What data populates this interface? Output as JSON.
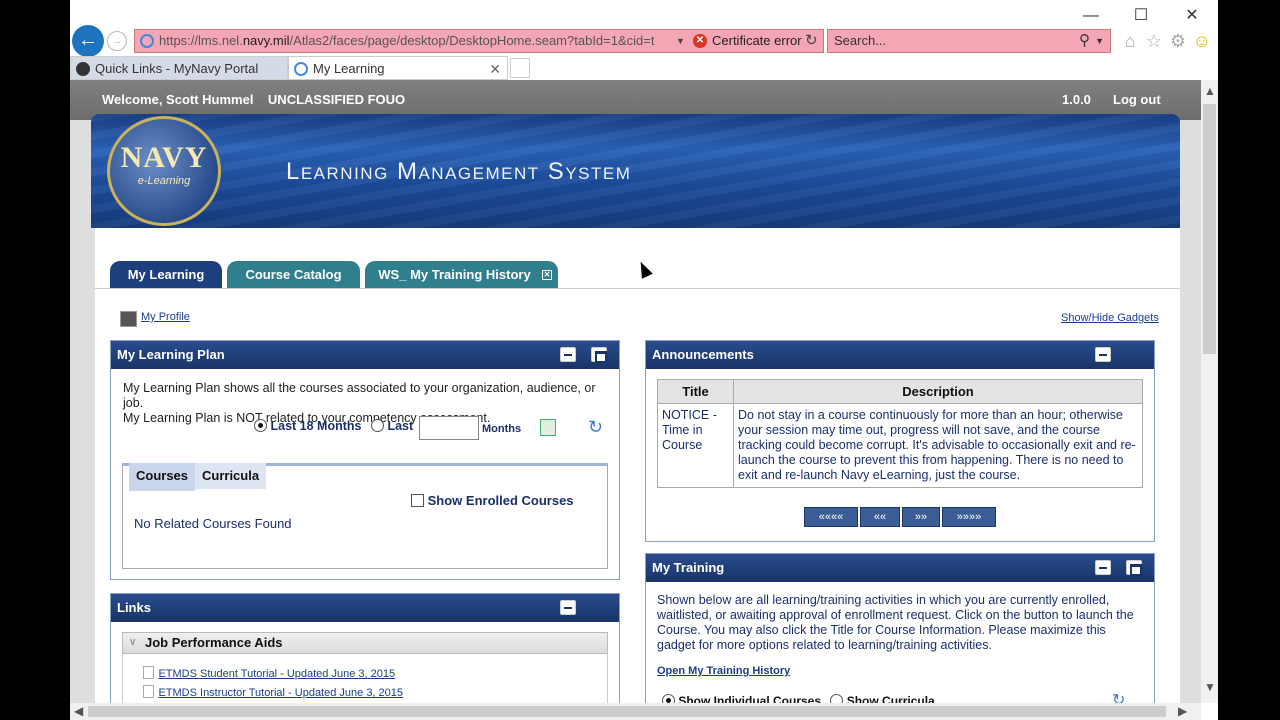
{
  "browser": {
    "url_prefix": "https://lms.nel.",
    "url_domain": "navy.mil",
    "url_suffix": "/Atlas2/faces/page/desktop/DesktopHome.seam?tabId=1&cid=t",
    "cert_error": "Certificate error",
    "search_placeholder": "Search...",
    "tabs": [
      {
        "label": "Quick Links - MyNavy Portal"
      },
      {
        "label": "My Learning"
      }
    ]
  },
  "header": {
    "welcome": "Welcome, Scott Hummel",
    "classification": "UNCLASSIFIED FOUO",
    "version": "1.0.0",
    "logout": "Log out",
    "logo_top": "NAVY",
    "logo_bottom": "e-Learning",
    "system_title": "Learning Management System"
  },
  "lms_tabs": [
    {
      "label": "My Learning",
      "active": true
    },
    {
      "label": "Course Catalog"
    },
    {
      "label": "WS_ My Training History"
    }
  ],
  "profile_link": "My Profile",
  "show_hide_gadgets": "Show/Hide Gadgets",
  "learning_plan": {
    "title": "My Learning Plan",
    "description_1": "My Learning Plan shows all the courses associated to your organization, audience, or job.",
    "description_2": "My Learning Plan is NOT related to your competency assessment.",
    "radio_last18": "Last 18 Months",
    "radio_last": "Last",
    "months": "Months",
    "months_value": "",
    "subtabs": [
      "Courses",
      "Curricula"
    ],
    "show_enrolled": "Show Enrolled Courses",
    "empty": "No Related Courses Found"
  },
  "links": {
    "title": "Links",
    "group": "Job Performance Aids",
    "items": [
      "ETMDS Student Tutorial - Updated June 3, 2015",
      "ETMDS Instructor Tutorial - Updated June 3, 2015"
    ]
  },
  "announcements": {
    "title": "Announcements",
    "col_title": "Title",
    "col_description": "Description",
    "rows": [
      {
        "title": "NOTICE - Time in Course",
        "description": "Do not stay in a course continuously for more than an hour; otherwise your session may time out, progress will not save, and the course tracking could become corrupt. It's advisable to occasionally exit and re-launch the course to prevent this from happening. There is no need to exit and re-launch Navy eLearning, just the course."
      }
    ],
    "pager": [
      "««««",
      "««",
      "»»",
      "»»»»"
    ]
  },
  "my_training": {
    "title": "My Training",
    "description": "Shown below are all learning/training activities in which you are currently enrolled, waitlisted, or awaiting approval of enrollment request. Click on the button to launch the Course. You may also click the Title for Course Information. Please maximize this gadget for more options related to learning/training activities.",
    "history_link": "Open My Training History",
    "radio_individual": "Show Individual Courses",
    "radio_curricula": "Show Curricula"
  },
  "colors": {
    "panel_header": "#1f3f7c",
    "tab_active": "#1d3f7e",
    "tab_teal": "#2f7f8c",
    "address_error": "#f4a6b5"
  }
}
